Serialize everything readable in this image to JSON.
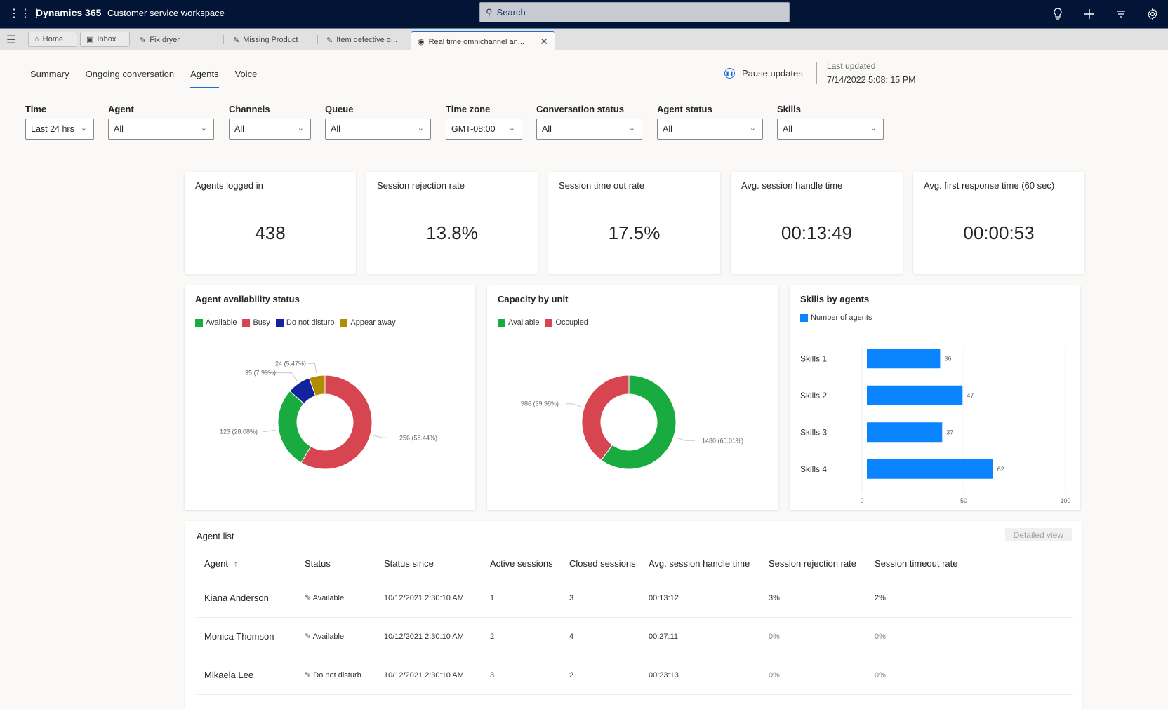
{
  "app": {
    "brand": "Dynamics 365",
    "workspace": "Customer service workspace",
    "search_placeholder": "Search",
    "top_icons": [
      "lightbulb-icon",
      "plus-icon",
      "filter-icon",
      "gear-icon"
    ]
  },
  "session_tabs": [
    {
      "label": "Home",
      "icon": "home-icon"
    },
    {
      "label": "Inbox",
      "icon": "inbox-icon"
    },
    {
      "label": "Fix dryer",
      "icon": "wrench-icon"
    },
    {
      "label": "Missing Product",
      "icon": "wrench-icon"
    },
    {
      "label": "Item defective o...",
      "icon": "wrench-icon"
    },
    {
      "label": "Real time omnichannel an...",
      "icon": "dashboard-icon",
      "active": true
    }
  ],
  "nav_tabs": [
    {
      "label": "Summary"
    },
    {
      "label": "Ongoing conversation"
    },
    {
      "label": "Agents",
      "active": true
    },
    {
      "label": "Voice"
    }
  ],
  "pause_updates": "Pause updates",
  "last_updated": {
    "label": "Last updated",
    "value": "7/14/2022 5:08: 15 PM"
  },
  "filters": [
    {
      "label": "Time",
      "value": "Last 24 hrs"
    },
    {
      "label": "Agent",
      "value": "All"
    },
    {
      "label": "Channels",
      "value": "All"
    },
    {
      "label": "Queue",
      "value": "All"
    },
    {
      "label": "Time zone",
      "value": "GMT-08:00"
    },
    {
      "label": "Conversation status",
      "value": "All"
    },
    {
      "label": "Agent status",
      "value": "All"
    },
    {
      "label": "Skills",
      "value": "All"
    }
  ],
  "kpis": [
    {
      "title": "Agents logged in",
      "value": "438"
    },
    {
      "title": "Session rejection rate",
      "value": "13.8%"
    },
    {
      "title": "Session time out rate",
      "value": "17.5%"
    },
    {
      "title": "Avg. session handle time",
      "value": "00:13:49"
    },
    {
      "title": "Avg. first response time (60 sec)",
      "value": "00:00:53"
    }
  ],
  "chart_data": [
    {
      "type": "pie",
      "title": "Agent availability status",
      "donut": true,
      "legend": "top-left",
      "slices": [
        {
          "name": "Busy",
          "value": 256,
          "percent": 58.44,
          "label": "256 (58.44%)",
          "color": "#d64550"
        },
        {
          "name": "Available",
          "value": 123,
          "percent": 28.08,
          "label": "123 (28.08%)",
          "color": "#1aab40"
        },
        {
          "name": "Do not disturb",
          "value": 35,
          "percent": 7.99,
          "label": "35 (7.99%)",
          "color": "#13239e"
        },
        {
          "name": "Appear away",
          "value": 24,
          "percent": 5.47,
          "label": "24 (5.47%)",
          "color": "#b28c00"
        }
      ],
      "legend_order": [
        "Available",
        "Busy",
        "Do not disturb",
        "Appear away"
      ]
    },
    {
      "type": "pie",
      "title": "Capacity by unit",
      "donut": true,
      "legend": "top-left",
      "slices": [
        {
          "name": "Available",
          "value": 1480,
          "percent": 60.01,
          "label": "1480 (60.01%)",
          "color": "#1aab40"
        },
        {
          "name": "Occupied",
          "value": 986,
          "percent": 39.98,
          "label": "986 (39.98%)",
          "color": "#d64550"
        }
      ],
      "legend_order": [
        "Available",
        "Occupied"
      ]
    },
    {
      "type": "bar",
      "orientation": "horizontal",
      "title": "Skills by agents",
      "legend": "top-left",
      "series": [
        {
          "name": "Number of agents",
          "color": "#0a84ff",
          "values": [
            36,
            47,
            37,
            62
          ]
        }
      ],
      "categories": [
        "Skills 1",
        "Skills 2",
        "Skills 3",
        "Skills 4"
      ],
      "xlim": [
        0,
        100
      ],
      "xticks": [
        "0",
        "50",
        "100"
      ],
      "grid": true
    }
  ],
  "agent_list": {
    "title": "Agent list",
    "detailed_view": "Detailed view",
    "columns": [
      "Agent",
      "Status",
      "Status since",
      "Active sessions",
      "Closed sessions",
      "Avg. session handle time",
      "Session rejection rate",
      "Session timeout rate"
    ],
    "rows": [
      [
        "Kiana Anderson",
        "Available",
        "10/12/2021 2:30:10 AM",
        "1",
        "3",
        "00:13:12",
        "3%",
        "2%"
      ],
      [
        "Monica Thomson",
        "Available",
        "10/12/2021 2:30:10 AM",
        "2",
        "4",
        "00:27:11",
        "0%",
        "0%"
      ],
      [
        "Mikaela Lee",
        "Do not disturb",
        "10/12/2021 2:30:10 AM",
        "3",
        "2",
        "00:23:13",
        "0%",
        "0%"
      ]
    ]
  }
}
